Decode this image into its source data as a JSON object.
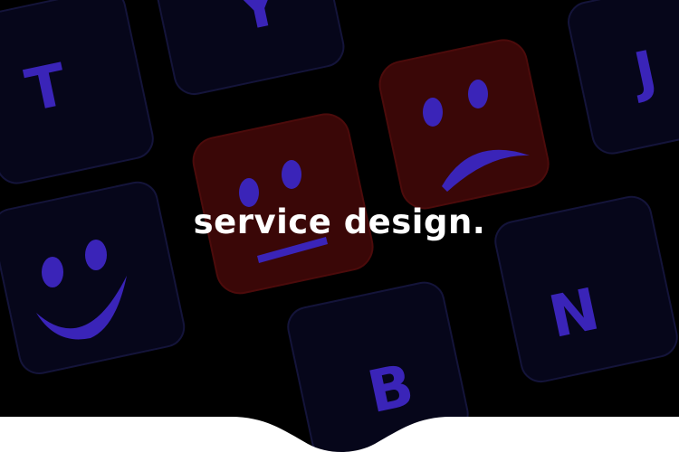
{
  "hero": {
    "headline": "service design.",
    "key_letters": {
      "t": "T",
      "y": "Y",
      "j": "J",
      "b": "B",
      "n": "N"
    },
    "faces": [
      {
        "name": "happy-face-icon",
        "mood": "happy"
      },
      {
        "name": "neutral-face-icon",
        "mood": "neutral"
      },
      {
        "name": "sad-face-icon",
        "mood": "sad"
      }
    ]
  },
  "colors": {
    "background": "#000000",
    "key": "#06061a",
    "key_edge": "#14143a",
    "glyph": "#3a24b8",
    "red_key": "#3a0707",
    "red_key_edge": "#4c0b0b",
    "text": "#ffffff",
    "footer": "#ffffff"
  }
}
